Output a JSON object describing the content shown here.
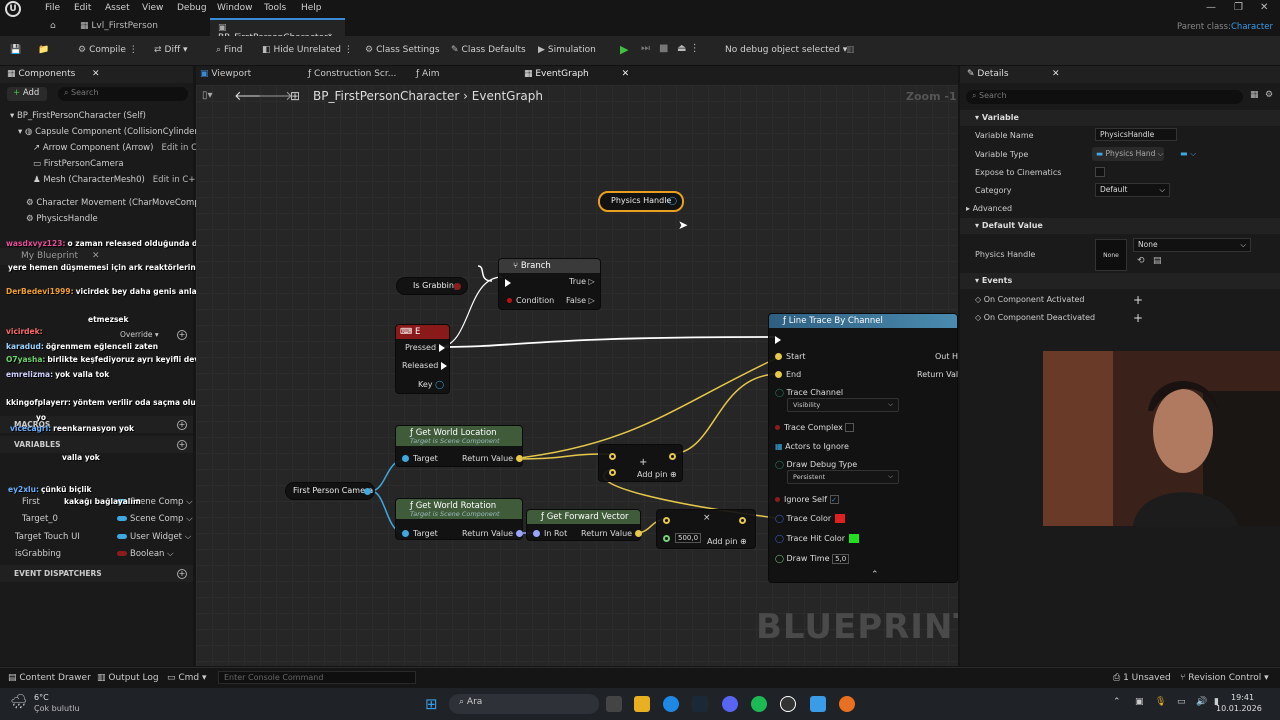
{
  "menubar": {
    "items": [
      "File",
      "Edit",
      "Asset",
      "View",
      "Debug",
      "Window",
      "Tools",
      "Help"
    ],
    "parent_class_label": "Parent class:",
    "parent_class_value": "Character"
  },
  "tabs": {
    "level_tab": "Lvl_FirstPerson",
    "bp_tab": "BP_FirstPersonCharacter*"
  },
  "toolbar": {
    "compile": "Compile",
    "diff": "Diff",
    "find": "Find",
    "hide_unrelated": "Hide Unrelated",
    "class_settings": "Class Settings",
    "class_defaults": "Class Defaults",
    "simulation": "Simulation",
    "debug_select": "No debug object selected"
  },
  "components": {
    "title": "Components",
    "add": "Add",
    "search_placeholder": "Search",
    "tree": [
      {
        "label": "BP_FirstPersonCharacter (Self)"
      },
      {
        "label": "Capsule Component (CollisionCylinder)"
      },
      {
        "label": "Arrow Component (Arrow)",
        "link": "Edit in C++"
      },
      {
        "label": "FirstPersonCamera"
      },
      {
        "label": "Mesh (CharacterMesh0)",
        "link": "Edit in C++"
      },
      {
        "label": "Character Movement (CharMoveComp)"
      },
      {
        "label": "PhysicsHandle"
      }
    ]
  },
  "mybp": {
    "title": "My Blueprint",
    "override": "Override",
    "macros": "MACROS",
    "variables": "VARIABLES",
    "event_dispatchers": "EVENT DISPATCHERS",
    "vars": [
      {
        "name": "First",
        "type": "Scene Comp",
        "color": "#3ea8e0"
      },
      {
        "name": "Target_0",
        "type": "Scene Comp",
        "color": "#3ea8e0"
      },
      {
        "name": "Target Touch UI",
        "type": "User Widget",
        "color": "#3ea8e0"
      },
      {
        "name": "isGrabbing",
        "type": "Boolean",
        "color": "#8c1c1c"
      }
    ]
  },
  "chat": [
    {
      "user": "wasdxvyz123:",
      "text": "o zaman released olduğunda da false yaparsın herhalde",
      "ucolor": "#e84f9a"
    },
    {
      "user": "",
      "text": "yere hemen düşmemesi için ark reaktörlerini stabilize edebilirsin 👍",
      "ucolor": "#e84f9a"
    },
    {
      "user": "DerBedevi1999:",
      "text": "vicirdek bey daha genis anlatmisiniz anlayamadikda",
      "ucolor": "#f0a030"
    },
    {
      "user": "",
      "text": "etmezsek",
      "ucolor": "#e84f9a"
    },
    {
      "user": "vicirdek:",
      "text": "",
      "ucolor": "#ff6a6a"
    },
    {
      "user": "karadud:",
      "text": "öğrenmem eğlenceli zaten",
      "ucolor": "#9ad4ff"
    },
    {
      "user": "O7yasha:",
      "text": "birlikte keşfediyoruz ayrı keyifli devam",
      "ucolor": "#6ad46a"
    },
    {
      "user": "emrelizma:",
      "text": "yok valla tok",
      "ucolor": "#d0d0ff"
    },
    {
      "user": "kkingofplayerr:",
      "text": "yöntem verilir oda saçma olur 👍",
      "ucolor": "#d0d0d0"
    },
    {
      "user": "",
      "text": "yo",
      "ucolor": "#e84f9a"
    },
    {
      "user": "vicecagri:",
      "text": "reenkarnasyon yok",
      "ucolor": "#6ab0ff"
    },
    {
      "user": "",
      "text": "valla yok",
      "ucolor": "#e84f9a"
    },
    {
      "user": "ey2xlu:",
      "text": "çünkü biçlik",
      "ucolor": "#6ab0ff"
    },
    {
      "user": "",
      "text": "kakağı bağlayalım",
      "ucolor": "#e84f9a"
    }
  ],
  "graph": {
    "tabs": [
      "Viewport",
      "Construction Scr...",
      "Aim",
      "EventGraph"
    ],
    "breadcrumb_bp": "BP_FirstPersonCharacter",
    "breadcrumb_graph": "EventGraph",
    "zoom": "Zoom -1",
    "watermark": "BLUEPRINT",
    "nodes": {
      "physics_handle": "Physics Handle",
      "is_grabbing": "Is Grabbing",
      "branch": {
        "title": "Branch",
        "true": "True",
        "false": "False",
        "condition": "Condition"
      },
      "e_key": {
        "title": "E",
        "pressed": "Pressed",
        "released": "Released",
        "key": "Key"
      },
      "get_world_location": {
        "title": "Get World Location",
        "sub": "Target is Scene Component",
        "target": "Target",
        "ret": "Return Value"
      },
      "get_world_rotation": {
        "title": "Get World Rotation",
        "sub": "Target is Scene Component",
        "target": "Target",
        "ret": "Return Value"
      },
      "get_forward_vector": {
        "title": "Get Forward Vector",
        "in": "In Rot",
        "ret": "Return Value"
      },
      "first_person_camera": "First Person Camera",
      "add_pin": "Add pin",
      "mult_value": "500,0",
      "line_trace": {
        "title": "Line Trace By Channel",
        "start": "Start",
        "end": "End",
        "out_hit": "Out H",
        "return_value": "Return Valu",
        "trace_channel": "Trace Channel",
        "trace_channel_value": "Visibility",
        "trace_complex": "Trace Complex",
        "actors_to_ignore": "Actors to Ignore",
        "draw_debug_type": "Draw Debug Type",
        "draw_debug_value": "Persistent",
        "ignore_self": "Ignore Self",
        "trace_color": "Trace Color",
        "trace_hit_color": "Trace Hit Color",
        "draw_time": "Draw Time",
        "draw_time_value": "5,0"
      }
    }
  },
  "details": {
    "title": "Details",
    "search_placeholder": "Search",
    "variable_section": "Variable",
    "variable_name_label": "Variable Name",
    "variable_name_value": "PhysicsHandle",
    "variable_type_label": "Variable Type",
    "variable_type_value": "Physics Hand",
    "expose_label": "Expose to Cinematics",
    "category_label": "Category",
    "category_value": "Default",
    "advanced": "Advanced",
    "default_value_section": "Default Value",
    "physics_handle_label": "Physics Handle",
    "physics_handle_thumb": "None",
    "physics_handle_value": "None",
    "events_section": "Events",
    "event1": "On Component Activated",
    "event2": "On Component Deactivated"
  },
  "statusbar": {
    "content_drawer": "Content Drawer",
    "output_log": "Output Log",
    "cmd": "Cmd",
    "console_placeholder": "Enter Console Command",
    "unsaved": "1 Unsaved",
    "revision": "Revision Control"
  },
  "taskbar": {
    "temp": "6°C",
    "weather": "Çok bulutlu",
    "search": "Ara",
    "time": "19:41",
    "date": "10.01.2026"
  },
  "colors": {
    "accent": "#3a8cd6",
    "exec_line": "#ffffff",
    "vector_wire": "#e6c84a",
    "trace_color": "#e02020",
    "trace_hit_color": "#20e020"
  }
}
